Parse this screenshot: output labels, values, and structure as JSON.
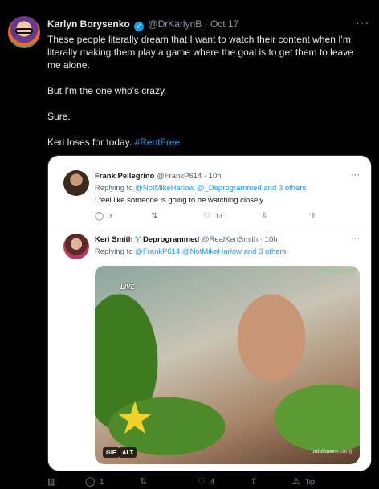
{
  "tweet": {
    "author_name": "Karlyn Borysenko",
    "author_handle": "@DrKarlynB",
    "separator": "·",
    "date": "Oct 17",
    "menu_icon": "more-dots-icon",
    "paragraphs": [
      "These people literally dream that I want to watch their content when I'm literally making them play a game where the goal is to get them to leave me alone.",
      "But I'm the one who's crazy.",
      "Sure."
    ],
    "last_line_text": "Keri loses for today.",
    "hashtag": "#RentFree"
  },
  "quote": {
    "tweet1": {
      "name": "Frank Pellegrino",
      "handle": "@FrankP614",
      "separator": "·",
      "time": "10h",
      "replying_prefix": "Replying to",
      "replying_targets": "@NotMikeHarlow @_Deprogrammed and 3 others",
      "text": "I feel like someone is going to be watching closely",
      "actions": {
        "reply_count": "3",
        "retweet_count": "",
        "like_count": "13"
      }
    },
    "tweet2": {
      "name": "Keri Smith",
      "name_suffix": "Deprogrammed",
      "handle": "@RealKeriSmith",
      "separator": "·",
      "time": "10h",
      "replying_prefix": "Replying to",
      "replying_targets": "@FrankP614 @NotMikeHarlow and 3 others",
      "gif": {
        "badge_gif": "GIF",
        "badge_alt": "ALT",
        "overlay_live": "LIVE",
        "watermark_top": "TRENDIZISST",
        "watermark_bottom": "[adultswim.com]"
      }
    }
  },
  "bottom_actions": {
    "analytics_icon": "analytics-icon",
    "reply_count": "1",
    "retweet_count": "",
    "like_count": "4",
    "tip_label": "Tip"
  },
  "colors": {
    "background": "#000000",
    "accent": "#1d9bf0",
    "muted": "#8b98a5",
    "card_background": "#ffffff"
  }
}
